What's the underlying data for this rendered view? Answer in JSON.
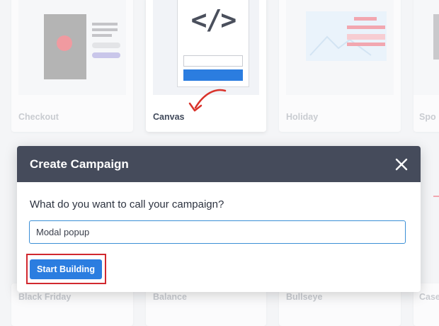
{
  "templates_row1": [
    {
      "name": "Checkout"
    },
    {
      "name": "Canvas"
    },
    {
      "name": "Holiday"
    },
    {
      "name": "Spo"
    }
  ],
  "templates_row2": [
    {
      "name": "Black Friday"
    },
    {
      "name": "Balance"
    },
    {
      "name": "Bullseye"
    },
    {
      "name": "Case"
    }
  ],
  "annotation": {
    "arrow_color": "#d9332b",
    "highlight_color": "#d1282f"
  },
  "modal": {
    "title": "Create Campaign",
    "prompt": "What do you want to call your campaign?",
    "input_value": "Modal popup",
    "start_label": "Start Building",
    "close_icon": "close-icon"
  },
  "colors": {
    "header_bg": "#454b5b",
    "accent": "#2b7de0",
    "input_border": "#3b8fd6"
  }
}
